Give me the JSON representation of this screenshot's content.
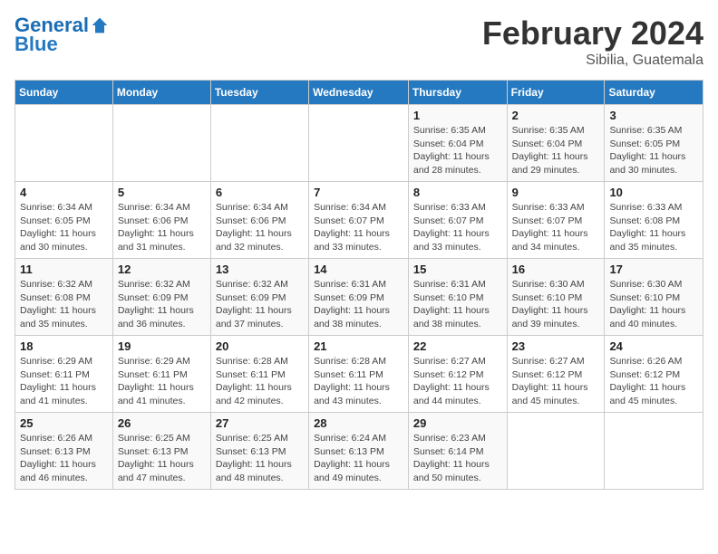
{
  "header": {
    "logo_line1": "General",
    "logo_line2": "Blue",
    "month_title": "February 2024",
    "subtitle": "Sibilia, Guatemala"
  },
  "days_of_week": [
    "Sunday",
    "Monday",
    "Tuesday",
    "Wednesday",
    "Thursday",
    "Friday",
    "Saturday"
  ],
  "weeks": [
    [
      {
        "num": "",
        "info": ""
      },
      {
        "num": "",
        "info": ""
      },
      {
        "num": "",
        "info": ""
      },
      {
        "num": "",
        "info": ""
      },
      {
        "num": "1",
        "info": "Sunrise: 6:35 AM\nSunset: 6:04 PM\nDaylight: 11 hours\nand 28 minutes."
      },
      {
        "num": "2",
        "info": "Sunrise: 6:35 AM\nSunset: 6:04 PM\nDaylight: 11 hours\nand 29 minutes."
      },
      {
        "num": "3",
        "info": "Sunrise: 6:35 AM\nSunset: 6:05 PM\nDaylight: 11 hours\nand 30 minutes."
      }
    ],
    [
      {
        "num": "4",
        "info": "Sunrise: 6:34 AM\nSunset: 6:05 PM\nDaylight: 11 hours\nand 30 minutes."
      },
      {
        "num": "5",
        "info": "Sunrise: 6:34 AM\nSunset: 6:06 PM\nDaylight: 11 hours\nand 31 minutes."
      },
      {
        "num": "6",
        "info": "Sunrise: 6:34 AM\nSunset: 6:06 PM\nDaylight: 11 hours\nand 32 minutes."
      },
      {
        "num": "7",
        "info": "Sunrise: 6:34 AM\nSunset: 6:07 PM\nDaylight: 11 hours\nand 33 minutes."
      },
      {
        "num": "8",
        "info": "Sunrise: 6:33 AM\nSunset: 6:07 PM\nDaylight: 11 hours\nand 33 minutes."
      },
      {
        "num": "9",
        "info": "Sunrise: 6:33 AM\nSunset: 6:07 PM\nDaylight: 11 hours\nand 34 minutes."
      },
      {
        "num": "10",
        "info": "Sunrise: 6:33 AM\nSunset: 6:08 PM\nDaylight: 11 hours\nand 35 minutes."
      }
    ],
    [
      {
        "num": "11",
        "info": "Sunrise: 6:32 AM\nSunset: 6:08 PM\nDaylight: 11 hours\nand 35 minutes."
      },
      {
        "num": "12",
        "info": "Sunrise: 6:32 AM\nSunset: 6:09 PM\nDaylight: 11 hours\nand 36 minutes."
      },
      {
        "num": "13",
        "info": "Sunrise: 6:32 AM\nSunset: 6:09 PM\nDaylight: 11 hours\nand 37 minutes."
      },
      {
        "num": "14",
        "info": "Sunrise: 6:31 AM\nSunset: 6:09 PM\nDaylight: 11 hours\nand 38 minutes."
      },
      {
        "num": "15",
        "info": "Sunrise: 6:31 AM\nSunset: 6:10 PM\nDaylight: 11 hours\nand 38 minutes."
      },
      {
        "num": "16",
        "info": "Sunrise: 6:30 AM\nSunset: 6:10 PM\nDaylight: 11 hours\nand 39 minutes."
      },
      {
        "num": "17",
        "info": "Sunrise: 6:30 AM\nSunset: 6:10 PM\nDaylight: 11 hours\nand 40 minutes."
      }
    ],
    [
      {
        "num": "18",
        "info": "Sunrise: 6:29 AM\nSunset: 6:11 PM\nDaylight: 11 hours\nand 41 minutes."
      },
      {
        "num": "19",
        "info": "Sunrise: 6:29 AM\nSunset: 6:11 PM\nDaylight: 11 hours\nand 41 minutes."
      },
      {
        "num": "20",
        "info": "Sunrise: 6:28 AM\nSunset: 6:11 PM\nDaylight: 11 hours\nand 42 minutes."
      },
      {
        "num": "21",
        "info": "Sunrise: 6:28 AM\nSunset: 6:11 PM\nDaylight: 11 hours\nand 43 minutes."
      },
      {
        "num": "22",
        "info": "Sunrise: 6:27 AM\nSunset: 6:12 PM\nDaylight: 11 hours\nand 44 minutes."
      },
      {
        "num": "23",
        "info": "Sunrise: 6:27 AM\nSunset: 6:12 PM\nDaylight: 11 hours\nand 45 minutes."
      },
      {
        "num": "24",
        "info": "Sunrise: 6:26 AM\nSunset: 6:12 PM\nDaylight: 11 hours\nand 45 minutes."
      }
    ],
    [
      {
        "num": "25",
        "info": "Sunrise: 6:26 AM\nSunset: 6:13 PM\nDaylight: 11 hours\nand 46 minutes."
      },
      {
        "num": "26",
        "info": "Sunrise: 6:25 AM\nSunset: 6:13 PM\nDaylight: 11 hours\nand 47 minutes."
      },
      {
        "num": "27",
        "info": "Sunrise: 6:25 AM\nSunset: 6:13 PM\nDaylight: 11 hours\nand 48 minutes."
      },
      {
        "num": "28",
        "info": "Sunrise: 6:24 AM\nSunset: 6:13 PM\nDaylight: 11 hours\nand 49 minutes."
      },
      {
        "num": "29",
        "info": "Sunrise: 6:23 AM\nSunset: 6:14 PM\nDaylight: 11 hours\nand 50 minutes."
      },
      {
        "num": "",
        "info": ""
      },
      {
        "num": "",
        "info": ""
      }
    ]
  ]
}
